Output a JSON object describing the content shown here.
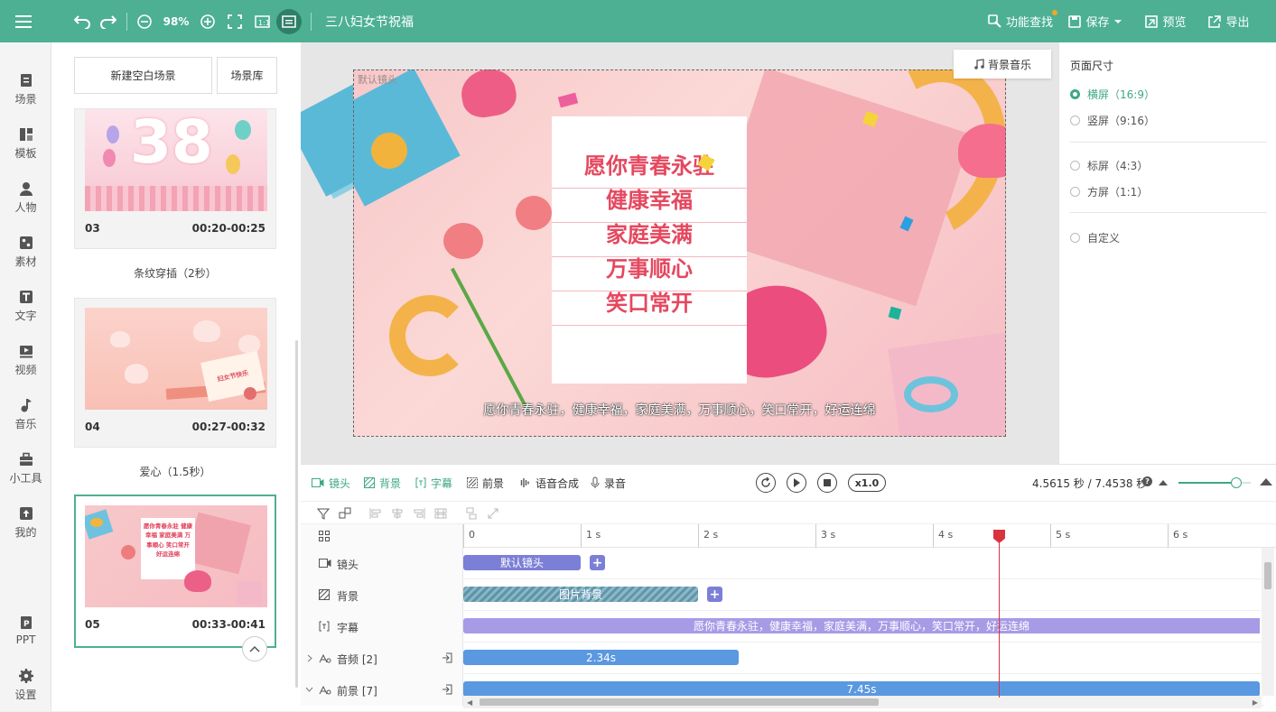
{
  "app": {
    "project_title": "三八妇女节祝福",
    "zoom": "98%"
  },
  "topbar": {
    "find_label": "功能查找",
    "save_label": "保存",
    "preview_label": "预览",
    "export_label": "导出"
  },
  "nav": [
    {
      "label": "场景",
      "icon": "scene-icon"
    },
    {
      "label": "模板",
      "icon": "template-icon"
    },
    {
      "label": "人物",
      "icon": "person-icon"
    },
    {
      "label": "素材",
      "icon": "material-icon"
    },
    {
      "label": "文字",
      "icon": "text-icon"
    },
    {
      "label": "视频",
      "icon": "video-icon"
    },
    {
      "label": "音乐",
      "icon": "music-icon"
    },
    {
      "label": "小工具",
      "icon": "toolbox-icon"
    },
    {
      "label": "我的",
      "icon": "upload-icon"
    },
    {
      "label": "PPT",
      "icon": "ppt-icon"
    },
    {
      "label": "设置",
      "icon": "gear-icon"
    }
  ],
  "scenes": {
    "new_blank": "新建空白场景",
    "library": "场景库",
    "cards": [
      {
        "num": "03",
        "time": "00:20-00:25",
        "thumb_text": "38"
      },
      {
        "num": "04",
        "time": "00:27-00:32",
        "thumb_text": "妇女节快乐"
      },
      {
        "num": "05",
        "time": "00:33-00:41",
        "thumb_text": "愿你青春永驻 健康幸福 家庭美满 万事顺心 笑口常开 好运连绵"
      }
    ],
    "transitions": [
      "条纹穿插（2秒）",
      "爱心（1.5秒）"
    ]
  },
  "canvas": {
    "camera_label": "默认镜头",
    "bg_music": "背景音乐",
    "card_lines": [
      "愿你青春永驻",
      "健康幸福",
      "家庭美满",
      "万事顺心",
      "笑口常开"
    ],
    "subtitle": "愿你青春永驻，健康幸福，家庭美满，万事顺心，笑口常开，好运连绵"
  },
  "page_size": {
    "title": "页面尺寸",
    "options": [
      "横屏（16:9）",
      "竖屏（9:16）",
      "标屏（4:3）",
      "方屏（1:1）",
      "自定义"
    ],
    "selected": 0
  },
  "timeline": {
    "tabs": [
      "镜头",
      "背景",
      "字幕",
      "前景",
      "语音合成",
      "录音"
    ],
    "speed": "x1.0",
    "time_display": "4.5615 秒 / 7.4538 秒",
    "zoom_level": 0.8,
    "playhead_seconds": 4.5615,
    "ticks": [
      "0",
      "1 s",
      "2 s",
      "3 s",
      "4 s",
      "5 s",
      "6 s"
    ],
    "tracks": [
      {
        "label": "镜头",
        "bar": "默认镜头"
      },
      {
        "label": "背景",
        "bar": "图片背景"
      },
      {
        "label": "字幕",
        "bar": "愿你青春永驻，健康幸福，家庭美满，万事顺心，笑口常开，好运连绵"
      },
      {
        "label": "音频 [2]",
        "bar": "2.34s"
      },
      {
        "label": "前景 [7]",
        "bar": "7.45s"
      }
    ]
  },
  "colors": {
    "brand": "#4db092",
    "accent": "#3ea885",
    "camera_bar": "#7b7fd6",
    "subtitle_bar": "#a79be6",
    "audio_bar": "#5a98e0",
    "playhead": "#d9333f"
  }
}
